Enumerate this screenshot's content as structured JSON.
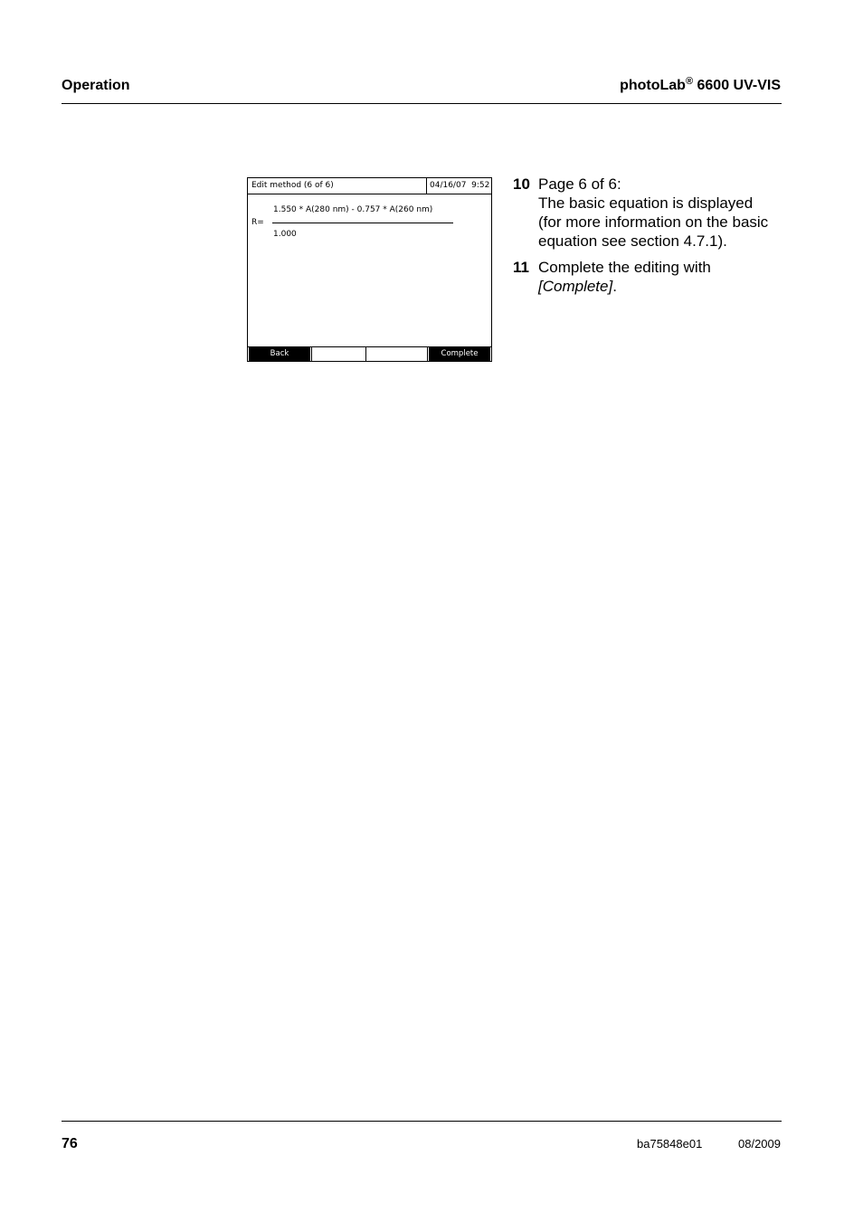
{
  "header": {
    "section": "Operation",
    "product_name": "photoLab",
    "product_mark": "®",
    "product_model": " 6600 UV-VIS"
  },
  "screen": {
    "title": "Edit method (6 of 6)",
    "datetime": "04/16/07  9:52",
    "numerator": "1.550 * A(280 nm) - 0.757 * A(260 nm)",
    "result_label": "R=",
    "denominator": "1.000",
    "softkeys": [
      "Back",
      "",
      "",
      "Complete"
    ]
  },
  "steps": [
    {
      "number": "10",
      "lines": [
        "Page 6 of 6:",
        "The basic equation is displayed",
        "(for more information on the basic",
        "equation see section 4.7.1)."
      ]
    },
    {
      "number": "11",
      "line1": "Complete the editing with",
      "action": "[Complete]",
      "punct": "."
    }
  ],
  "footer": {
    "page_number": "76",
    "doc_id": "ba75848e01",
    "date": "08/2009"
  }
}
